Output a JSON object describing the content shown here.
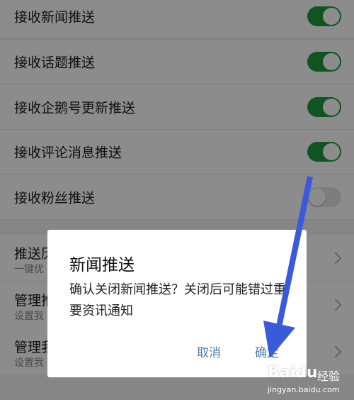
{
  "settings": {
    "items": [
      {
        "label": "接收新闻推送",
        "enabled": true
      },
      {
        "label": "接收话题推送",
        "enabled": true
      },
      {
        "label": "接收企鹅号更新推送",
        "enabled": true
      },
      {
        "label": "接收评论消息推送",
        "enabled": true
      },
      {
        "label": "接收粉丝推送",
        "enabled": false
      }
    ],
    "group2": [
      {
        "label": "推送历",
        "sub": "一键优"
      },
      {
        "label": "管理推",
        "sub": "设置我"
      },
      {
        "label": "管理我",
        "sub": "设置我"
      }
    ]
  },
  "dialog": {
    "title": "新闻推送",
    "message": "确认关闭新闻推送？关闭后可能错过重要资讯通知",
    "cancel_label": "取消",
    "confirm_label": "确定"
  },
  "watermark": {
    "logo": "Baidu",
    "text": "经验",
    "url": "jingyan.baidu.com"
  },
  "colors": {
    "toggle_on": "#1d9a3c",
    "dialog_button": "#4f7ba8",
    "annotation_arrow": "#3a5bd9"
  }
}
